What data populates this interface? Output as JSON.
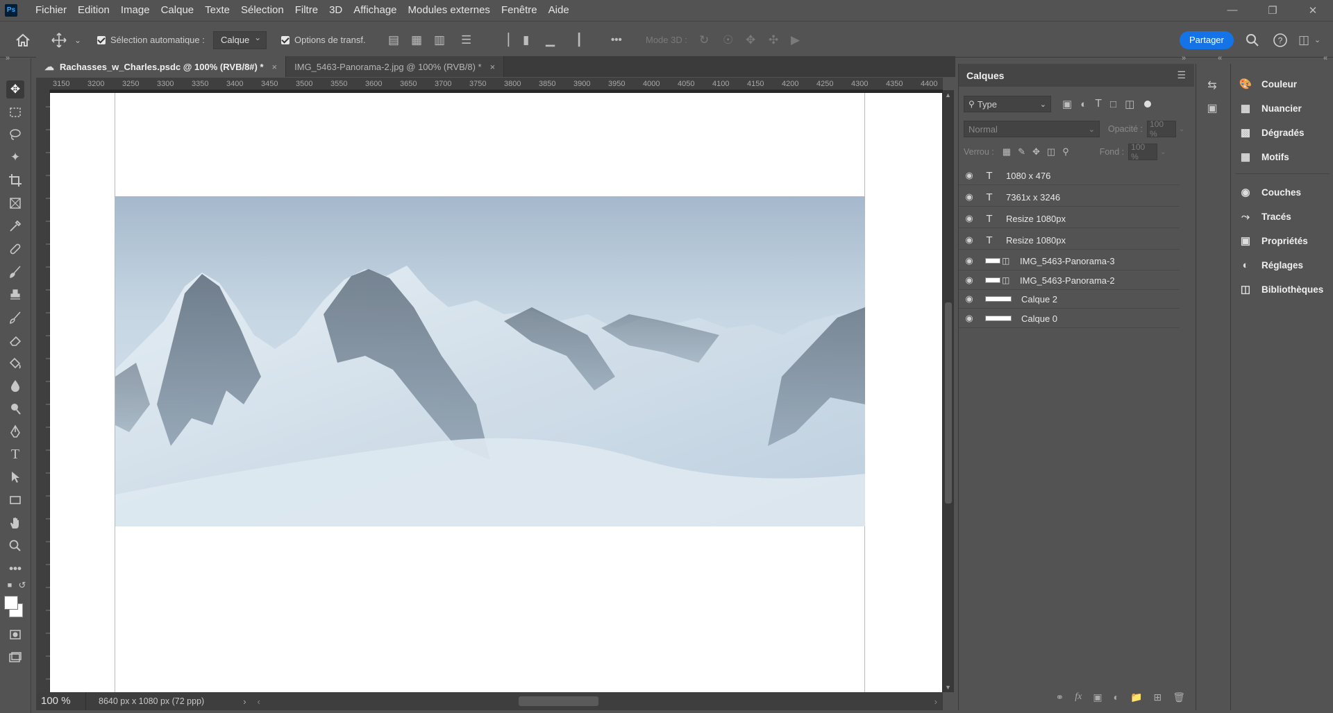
{
  "app": {
    "logo": "Ps",
    "menu": [
      "Fichier",
      "Edition",
      "Image",
      "Calque",
      "Texte",
      "Sélection",
      "Filtre",
      "3D",
      "Affichage",
      "Modules externes",
      "Fenêtre",
      "Aide"
    ]
  },
  "options_bar": {
    "auto_select_label": "Sélection automatique :",
    "auto_select_value": "Calque",
    "transform_label": "Options de transf.",
    "more": "•••",
    "mode3d_label": "Mode 3D :",
    "share_label": "Partager"
  },
  "tabs": [
    {
      "label": "Rachasses_w_Charles.psdc @ 100% (RVB/8#) *",
      "close": "×"
    },
    {
      "label": "IMG_5463-Panorama-2.jpg @ 100% (RVB/8) *",
      "close": "×"
    }
  ],
  "ruler": {
    "ticks": [
      "3150",
      "3200",
      "3250",
      "3300",
      "3350",
      "3400",
      "3450",
      "3500",
      "3550",
      "3600",
      "3650",
      "3700",
      "3750",
      "3800",
      "3850",
      "3900",
      "3950",
      "4000",
      "4050",
      "4100",
      "4150",
      "4200",
      "4250",
      "4300",
      "4350",
      "4400"
    ]
  },
  "status": {
    "zoom": "100 %",
    "doc_size": "8640 px x 1080 px (72 ppp)"
  },
  "layers_panel": {
    "title": "Calques",
    "filter_type": "Type",
    "blend_mode": "Normal",
    "opacity_label": "Opacité :",
    "opacity_value": "100 %",
    "lock_label": "Verrou :",
    "fill_label": "Fond :",
    "fill_value": "100 %",
    "layers": [
      {
        "name": "1080 x 476",
        "kind": "text"
      },
      {
        "name": "7361x x 3246",
        "kind": "text"
      },
      {
        "name": "Resize 1080px",
        "kind": "text"
      },
      {
        "name": "Resize 1080px",
        "kind": "text"
      },
      {
        "name": "IMG_5463-Panorama-3",
        "kind": "smart"
      },
      {
        "name": "IMG_5463-Panorama-2",
        "kind": "smart"
      },
      {
        "name": "Calque 2",
        "kind": "pixel"
      },
      {
        "name": "Calque 0",
        "kind": "pixel"
      }
    ]
  },
  "right_panels": [
    "Couleur",
    "Nuancier",
    "Dégradés",
    "Motifs",
    "Couches",
    "Tracés",
    "Propriétés",
    "Réglages",
    "Bibliothèques"
  ],
  "colors": {
    "accent": "#1473e6",
    "guide": "#5ee0e6",
    "ui_bg": "#535353"
  }
}
